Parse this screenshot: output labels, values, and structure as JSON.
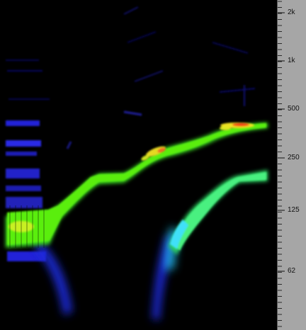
{
  "ruler": {
    "labels": [
      {
        "text": "2k",
        "hz": 2000
      },
      {
        "text": "1k",
        "hz": 1000
      },
      {
        "text": "500",
        "hz": 500
      },
      {
        "text": "250",
        "hz": 250
      },
      {
        "text": "125",
        "hz": 125
      },
      {
        "text": "62",
        "hz": 62
      }
    ]
  },
  "colors": {
    "background": "#000000",
    "ruler_bg": "#a6a6a6"
  }
}
